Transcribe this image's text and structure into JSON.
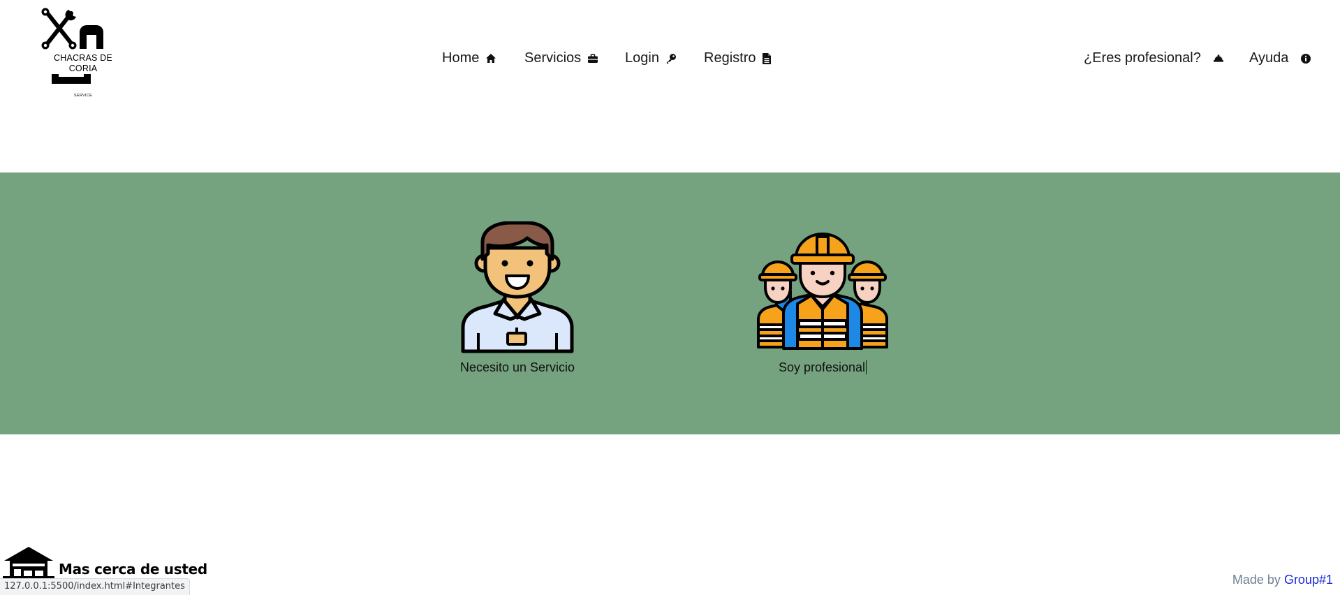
{
  "header": {
    "logo": {
      "name": "CHACRAS DE CORIA",
      "subtitle": "SERVICE"
    },
    "nav_left": [
      {
        "label": "Home",
        "icon": "home-icon"
      },
      {
        "label": "Servicios",
        "icon": "briefcase-icon"
      },
      {
        "label": "Login",
        "icon": "key-icon"
      },
      {
        "label": "Registro",
        "icon": "file-icon"
      }
    ],
    "nav_right": [
      {
        "label": "¿Eres profesional?",
        "icon": "hard-hat-icon"
      },
      {
        "label": "Ayuda",
        "icon": "info-circle-icon"
      }
    ]
  },
  "hero": {
    "background_color": "#75a37f",
    "cards": [
      {
        "label": "Necesito un Servicio",
        "image": "customer-avatar-illustration"
      },
      {
        "label": "Soy profesional",
        "image": "construction-workers-illustration"
      }
    ]
  },
  "footer": {
    "brand_text": "Mas cerca de usted",
    "brand_icon": "house-icon",
    "made_by_prefix": "Made by",
    "made_by_link": "Group#1"
  },
  "browser_status": {
    "url": "127.0.0.1:5500/index.html#Integrantes"
  }
}
